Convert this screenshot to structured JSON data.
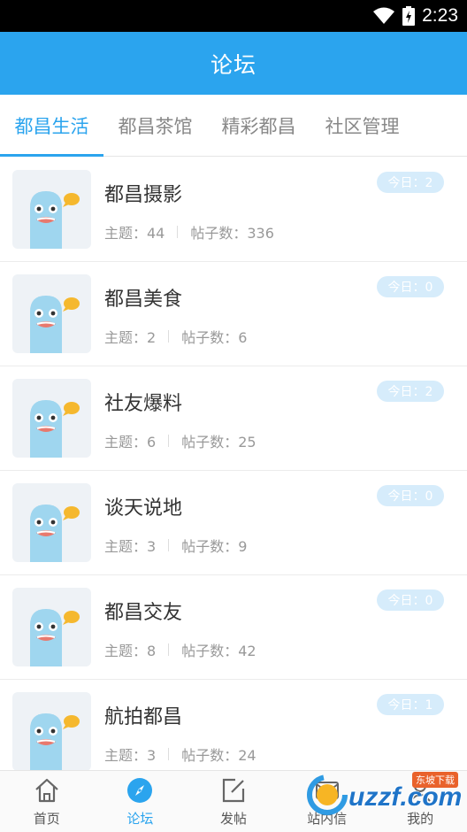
{
  "status_bar": {
    "time": "2:23"
  },
  "header": {
    "title": "论坛"
  },
  "tabs": [
    {
      "label": "都昌生活",
      "active": true
    },
    {
      "label": "都昌茶馆",
      "active": false
    },
    {
      "label": "精彩都昌",
      "active": false
    },
    {
      "label": "社区管理",
      "active": false
    }
  ],
  "forums": [
    {
      "name": "都昌摄影",
      "topics_label": "主题：44",
      "posts_label": "帖子数：336",
      "today_label": "今日：2"
    },
    {
      "name": "都昌美食",
      "topics_label": "主题：2",
      "posts_label": "帖子数：6",
      "today_label": "今日：0"
    },
    {
      "name": "社友爆料",
      "topics_label": "主题：6",
      "posts_label": "帖子数：25",
      "today_label": "今日：2"
    },
    {
      "name": "谈天说地",
      "topics_label": "主题：3",
      "posts_label": "帖子数：9",
      "today_label": "今日：0"
    },
    {
      "name": "都昌交友",
      "topics_label": "主题：8",
      "posts_label": "帖子数：42",
      "today_label": "今日：0"
    },
    {
      "name": "航拍都昌",
      "topics_label": "主题：3",
      "posts_label": "帖子数：24",
      "today_label": "今日：1"
    }
  ],
  "bottom_nav": [
    {
      "label": "首页",
      "icon": "home-icon",
      "active": false
    },
    {
      "label": "论坛",
      "icon": "compass-icon",
      "active": true
    },
    {
      "label": "发帖",
      "icon": "compose-icon",
      "active": false
    },
    {
      "label": "站内信",
      "icon": "message-icon",
      "active": false
    },
    {
      "label": "我的",
      "icon": "profile-icon",
      "active": false
    }
  ],
  "watermark": {
    "text": "uzzf.com",
    "tag": "东坡下载"
  },
  "colors": {
    "primary": "#2ba4ee",
    "badge_bg": "#d6ecfb",
    "mascot": "#9fd6ef",
    "speech_bubble": "#f5b82e"
  }
}
